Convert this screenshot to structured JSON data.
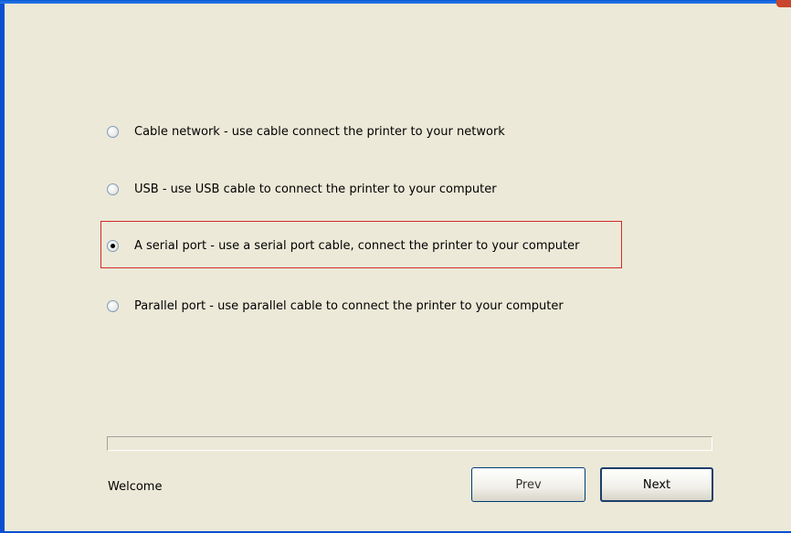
{
  "options": [
    {
      "label": "Cable network - use cable connect the printer to your network",
      "checked": false
    },
    {
      "label": "USB - use USB cable to connect the printer to your computer",
      "checked": false
    },
    {
      "label": "A serial port - use a serial port cable, connect the printer to your computer",
      "checked": true
    },
    {
      "label": "Parallel port - use parallel cable to connect the printer to your computer",
      "checked": false
    }
  ],
  "progress": {
    "fraction": 0
  },
  "status_text": "Welcome",
  "buttons": {
    "prev_label": "Prev",
    "next_label": "Next"
  },
  "colors": {
    "background": "#ece9d8",
    "highlight_border": "#d22a2a",
    "title_bar": "#0a5bd6"
  }
}
